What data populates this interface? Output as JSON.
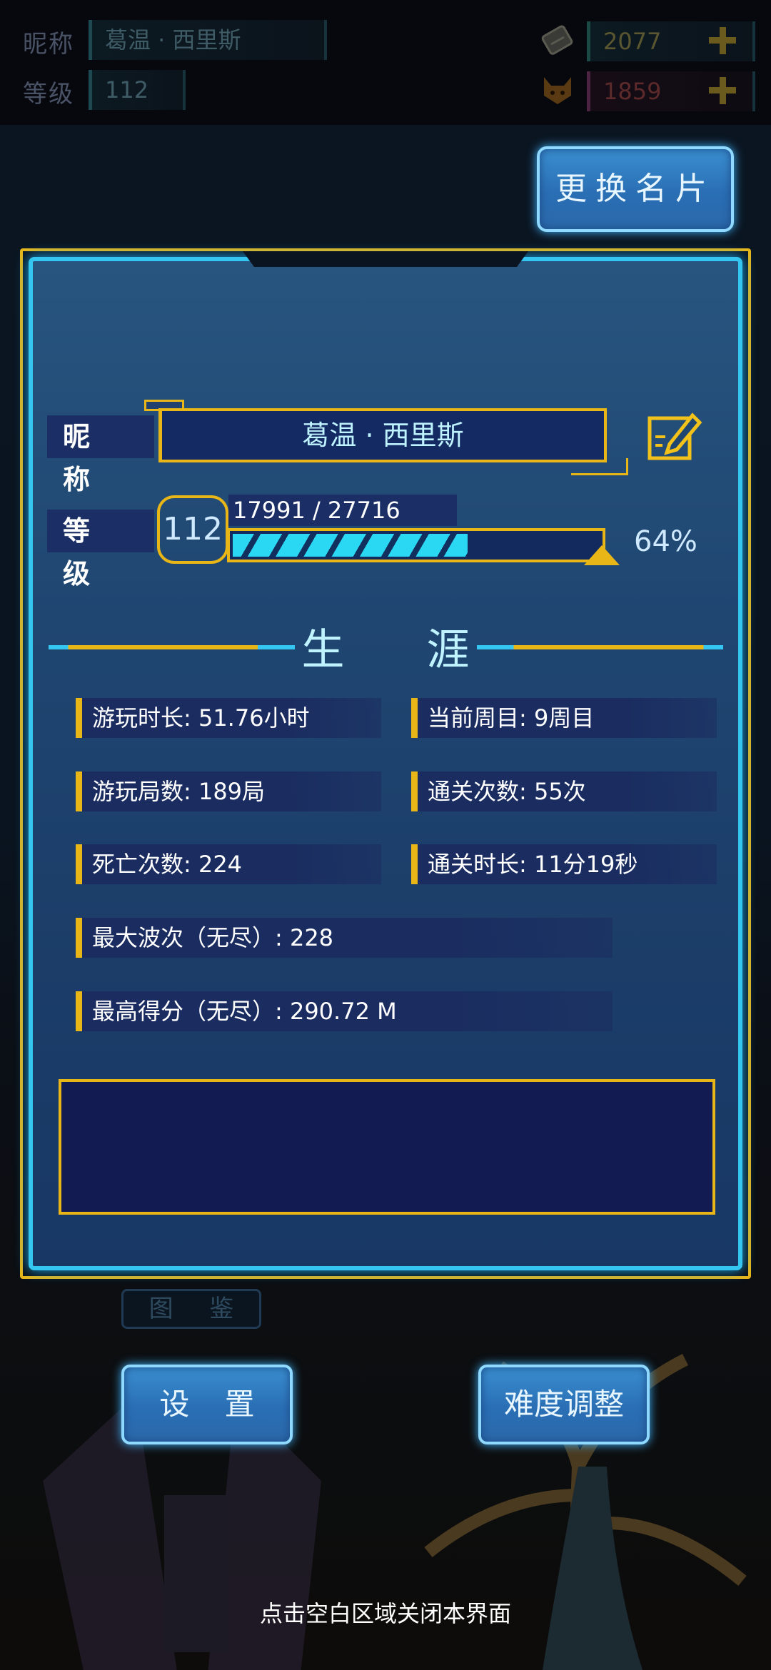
{
  "topbar": {
    "nickname_label": "昵称",
    "nickname_value": "葛温 · 西里斯",
    "level_label": "等级",
    "level_value": "112",
    "currency_a": "2077",
    "currency_b": "1859"
  },
  "change_card_label": "更换名片",
  "profile": {
    "nickname_label": "昵 称",
    "nickname": "葛温 · 西里斯",
    "level_label": "等 级",
    "level": "112",
    "xp_text": "17991 / 27716",
    "xp_fraction": 0.64,
    "xp_percent": "64%"
  },
  "career": {
    "title": "生 涯",
    "stats": {
      "play_time": "游玩时长: 51.76小时",
      "current_cycle": "当前周目: 9周目",
      "rounds_played": "游玩局数: 189局",
      "clears": "通关次数: 55次",
      "deaths": "死亡次数: 224",
      "clear_time": "通关时长: 11分19秒",
      "max_wave": "最大波次（无尽）: 228",
      "high_score": "最高得分（无尽）: 290.72 M"
    }
  },
  "scene": {
    "codex_label": "图 鉴",
    "settings_label": "设 置",
    "difficulty_label": "难度调整"
  },
  "close_hint": "点击空白区域关闭本界面",
  "colors": {
    "accent_gold": "#e9b617",
    "accent_cyan": "#34c6f0",
    "panel_bg": "#1f4671"
  }
}
